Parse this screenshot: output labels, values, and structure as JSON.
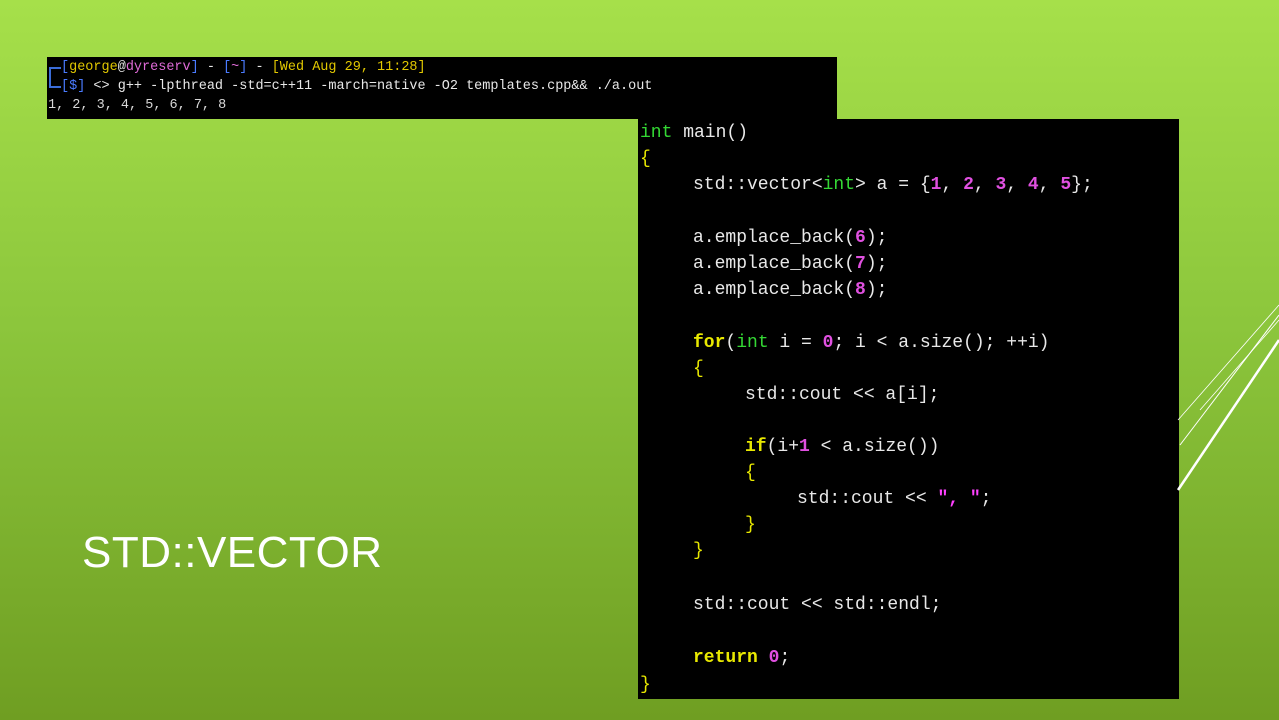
{
  "terminal": {
    "line1": {
      "open": "[",
      "user": "george",
      "at": "@",
      "host": "dyreserv",
      "close": "]",
      "sep1": " - ",
      "dir_open": "[",
      "dir": "~",
      "dir_close": "]",
      "sep2": " - ",
      "date": "[Wed Aug 29, 11:28]"
    },
    "line2": {
      "prompt": "[$]",
      "arrows": " <> ",
      "command": "g++ -lpthread -std=c++11 -march=native -O2 templates.cpp&& ./a.out"
    },
    "output": "1, 2, 3, 4, 5, 6, 7, 8"
  },
  "code": {
    "l1_kw": "int",
    "l1_rest": " main()",
    "open_brace": "{",
    "vec_pre": "std::vector<",
    "vec_type": "int",
    "vec_mid": "> a = {",
    "vec_n1": "1",
    "vec_n2": "2",
    "vec_n3": "3",
    "vec_n4": "4",
    "vec_n5": "5",
    "vec_end": "};",
    "emp_pre": "a.emplace_back(",
    "emp_n6": "6",
    "emp_n7": "7",
    "emp_n8": "8",
    "emp_end": ");",
    "for_kw": "for",
    "for_open": "(",
    "for_type": "int",
    "for_mid": " i = ",
    "for_zero": "0",
    "for_rest": "; i < a.size(); ++i)",
    "for_brace": "{",
    "cout_a": "std::cout << a[i];",
    "if_kw": "if",
    "if_open": "(i+",
    "if_one": "1",
    "if_rest": " < a.size())",
    "if_brace": "{",
    "cout_sep_pre": "std::cout << ",
    "cout_sep_str": "\", \"",
    "cout_sep_end": ";",
    "if_close": "}",
    "for_close": "}",
    "cout_endl": "std::cout << std::endl;",
    "ret_kw": "return",
    "ret_zero": "0",
    "ret_end": ";",
    "close_brace": "}"
  },
  "slide": {
    "title": "STD::VECTOR"
  },
  "colors": {
    "background_top": "#a6e04a",
    "background_bottom": "#6f9e22",
    "terminal_bg": "#000000",
    "keyword": "#e8e800",
    "type": "#34d834",
    "number": "#e050e0"
  }
}
